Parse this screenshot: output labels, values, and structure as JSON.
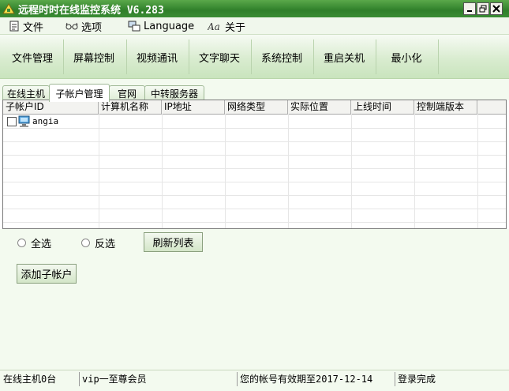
{
  "window": {
    "title": "远程时时在线监控系统 V6.283"
  },
  "menu": {
    "items": [
      {
        "label": "文件",
        "icon": "file-icon"
      },
      {
        "label": "选项",
        "icon": "glasses-icon"
      },
      {
        "label": "Language",
        "icon": "language-icon"
      },
      {
        "label": "关于",
        "icon": "about-icon"
      }
    ]
  },
  "toolbar": {
    "buttons": [
      "文件管理",
      "屏幕控制",
      "视频通讯",
      "文字聊天",
      "系统控制",
      "重启关机",
      "最小化"
    ]
  },
  "tabs": {
    "items": [
      "在线主机",
      "子帐户管理",
      "官网",
      "中转服务器"
    ],
    "active": "子帐户管理"
  },
  "table": {
    "columns": [
      "子帐户ID",
      "计算机名称",
      "IP地址",
      "网络类型",
      "实际位置",
      "上线时间",
      "控制端版本"
    ],
    "rows": [
      {
        "id": "angia",
        "checked": false
      }
    ]
  },
  "controls": {
    "select_all": "全选",
    "invert_select": "反选",
    "refresh": "刷新列表",
    "add_sub_account": "添加子帐户"
  },
  "status": {
    "online": "在线主机0台",
    "vip": "vip一至尊会员",
    "expiry": "您的帐号有效期至2017-12-14",
    "login": "登录完成"
  },
  "colors": {
    "titlebar": "#2f7f2a",
    "toolbar": "#d9ecd0",
    "panel": "#f3faef"
  }
}
